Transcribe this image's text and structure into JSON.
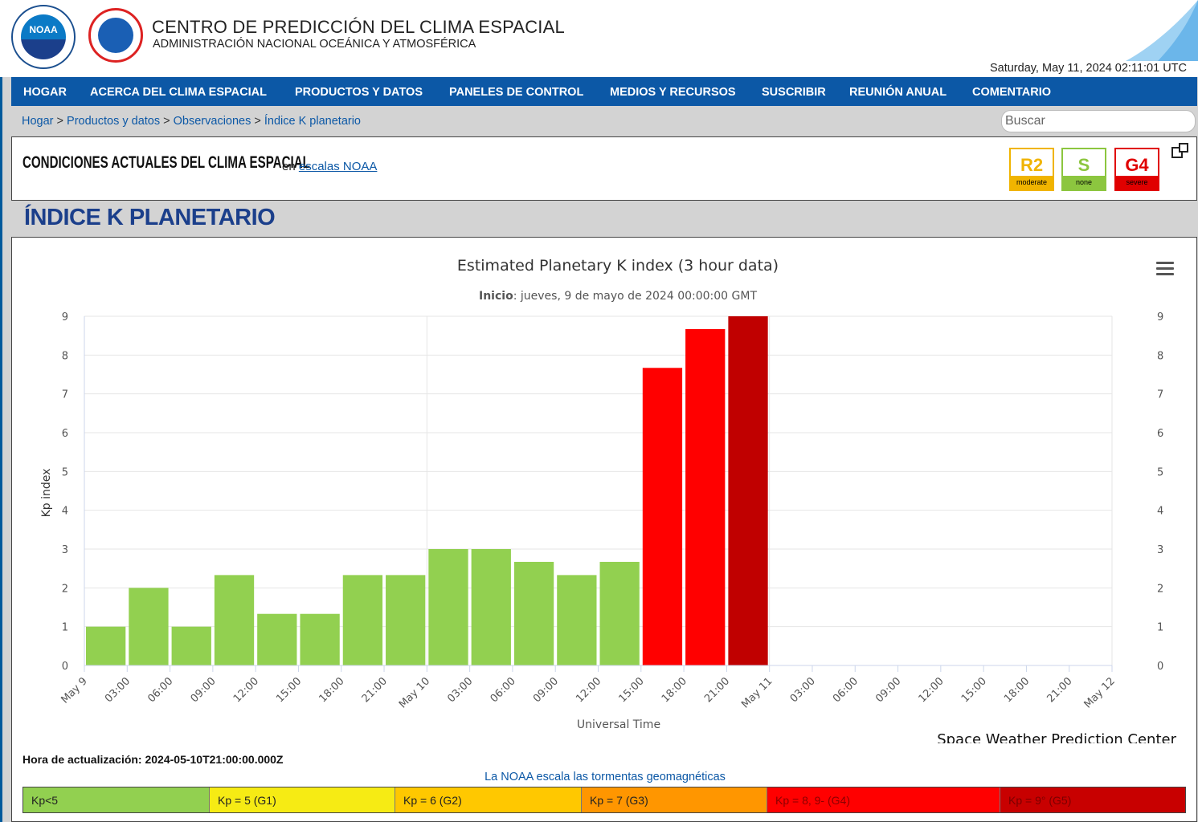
{
  "header": {
    "noaa_logo_text": "NOAA",
    "title": "CENTRO DE PREDICCIÓN DEL CLIMA ESPACIAL",
    "subtitle": "ADMINISTRACIÓN NACIONAL OCEÁNICA Y ATMOSFÉRICA",
    "datetime": "Saturday, May 11, 2024 02:11:01 UTC"
  },
  "nav": {
    "items": [
      "HOGAR",
      "ACERCA DEL CLIMA ESPACIAL",
      "PRODUCTOS Y DATOS",
      "PANELES DE CONTROL",
      "MEDIOS Y RECURSOS",
      "SUSCRIBIR",
      "REUNIÓN ANUAL",
      "COMENTARIO"
    ]
  },
  "breadcrumb": {
    "items": [
      "Hogar",
      "Productos y datos",
      "Observaciones",
      "Índice K planetario"
    ],
    "separator": ">"
  },
  "search": {
    "placeholder": "Buscar"
  },
  "conditions": {
    "title": "CONDICIONES ACTUALES DEL CLIMA ESPACIAL",
    "en": "en",
    "link": "escalas NOAA",
    "scales": [
      {
        "label": "R2",
        "level": "moderate",
        "color": "#f0b400",
        "bg": "#f0b400"
      },
      {
        "label": "S",
        "level": "none",
        "color": "#8cc63f",
        "bg": "#8cc63f"
      },
      {
        "label": "G4",
        "level": "severe",
        "color": "#e00000",
        "bg": "#e00000"
      }
    ]
  },
  "page_title": "ÍNDICE K PLANETARIO",
  "chart_data": {
    "type": "bar",
    "title": "Estimated Planetary K index (3 hour data)",
    "subtitle_label": "Inicio",
    "subtitle": ": jueves, 9 de mayo de 2024 00:00:00 GMT",
    "xlabel": "Universal Time",
    "ylabel": "Kp index",
    "credit": "Space Weather Prediction Center",
    "ylim": [
      0,
      9
    ],
    "yticks": [
      0,
      1,
      2,
      3,
      4,
      5,
      6,
      7,
      8,
      9
    ],
    "x_tick_labels": [
      "May 9",
      "03:00",
      "06:00",
      "09:00",
      "12:00",
      "15:00",
      "18:00",
      "21:00",
      "May 10",
      "03:00",
      "06:00",
      "09:00",
      "12:00",
      "15:00",
      "18:00",
      "21:00",
      "May 11",
      "03:00",
      "06:00",
      "09:00",
      "12:00",
      "15:00",
      "18:00",
      "21:00",
      "May 12"
    ],
    "x_start": "2024-05-09T00:00:00Z",
    "x_end": "2024-05-12T00:00:00Z",
    "bar_start_times": [
      "2024-05-09T00:00Z",
      "2024-05-09T03:00Z",
      "2024-05-09T06:00Z",
      "2024-05-09T09:00Z",
      "2024-05-09T12:00Z",
      "2024-05-09T15:00Z",
      "2024-05-09T18:00Z",
      "2024-05-09T21:00Z",
      "2024-05-10T00:00Z",
      "2024-05-10T03:00Z",
      "2024-05-10T06:00Z",
      "2024-05-10T09:00Z",
      "2024-05-10T12:00Z",
      "2024-05-10T15:00Z",
      "2024-05-10T18:00Z",
      "2024-05-10T21:00Z"
    ],
    "values": [
      1.0,
      2.0,
      1.0,
      2.33,
      1.33,
      1.33,
      2.33,
      2.33,
      3.0,
      3.0,
      2.67,
      2.33,
      2.67,
      7.67,
      8.67,
      9.0
    ],
    "bar_colors": [
      "#92d050",
      "#92d050",
      "#92d050",
      "#92d050",
      "#92d050",
      "#92d050",
      "#92d050",
      "#92d050",
      "#92d050",
      "#92d050",
      "#92d050",
      "#92d050",
      "#92d050",
      "#ff0000",
      "#ff0000",
      "#c00000"
    ],
    "grid": true,
    "y_axis_both_sides": true
  },
  "update_time": "Hora de actualización: 2024-05-10T21:00:00.000Z",
  "scale_link": "La NOAA escala las tormentas geomagnéticas",
  "kp_legend": [
    {
      "label": "Kp<5",
      "color": "#92d050",
      "text_color": "#222"
    },
    {
      "label": "Kp = 5 (G1)",
      "color": "#f6eb14",
      "text_color": "#222"
    },
    {
      "label": "Kp = 6 (G2)",
      "color": "#ffc800",
      "text_color": "#222"
    },
    {
      "label": "Kp = 7 (G3)",
      "color": "#ff9600",
      "text_color": "#222"
    },
    {
      "label": "Kp = 8, 9- (G4)",
      "color": "#ff0000",
      "text_color": "#8a0000"
    },
    {
      "label": "Kp = 9° (G5)",
      "color": "#c80000",
      "text_color": "#7a0000"
    }
  ]
}
